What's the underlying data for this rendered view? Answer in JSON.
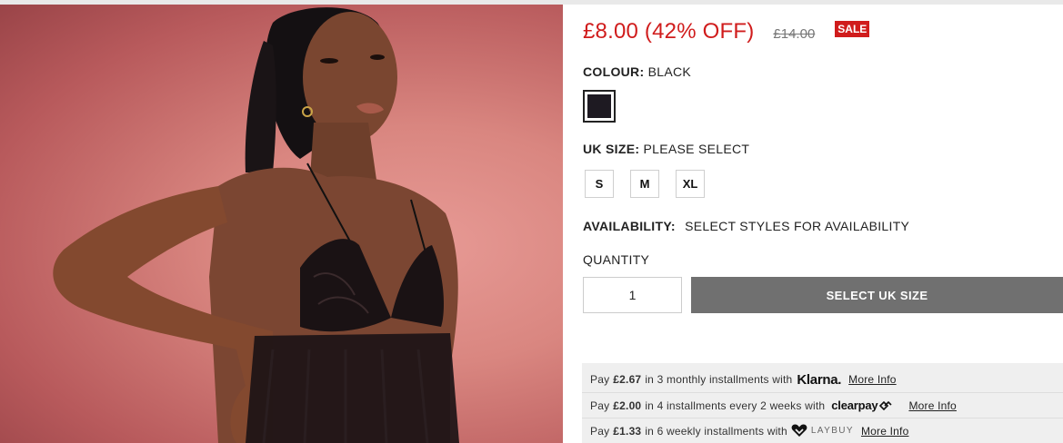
{
  "product": {
    "price_now": "£8.00 (42% OFF)",
    "price_was": "£14.00",
    "sale_badge": "SALE"
  },
  "colour": {
    "label": "COLOUR:",
    "value": "BLACK",
    "swatch_color": "#1e1a22"
  },
  "size": {
    "label": "UK SIZE:",
    "value": "PLEASE SELECT",
    "options": [
      "S",
      "M",
      "XL"
    ]
  },
  "availability": {
    "label": "AVAILABILITY:",
    "value": "SELECT STYLES FOR AVAILABILITY"
  },
  "quantity": {
    "label": "QUANTITY",
    "value": "1"
  },
  "add_button": {
    "label": "SELECT UK SIZE"
  },
  "payments": [
    {
      "prefix": "Pay",
      "amount": "£2.67",
      "text": "in 3 monthly installments with",
      "provider": "Klarna.",
      "link": "More Info"
    },
    {
      "prefix": "Pay",
      "amount": "£2.00",
      "text": "in 4 installments every 2 weeks with",
      "provider": "clearpay",
      "link": "More Info"
    },
    {
      "prefix": "Pay",
      "amount": "£1.33",
      "text": "in 6 weekly installments with",
      "provider": "LAYBUY",
      "link": "More Info"
    }
  ],
  "colors": {
    "sale_red": "#d01c1c",
    "button_grey": "#707070",
    "pay_box_bg": "#efefef"
  }
}
